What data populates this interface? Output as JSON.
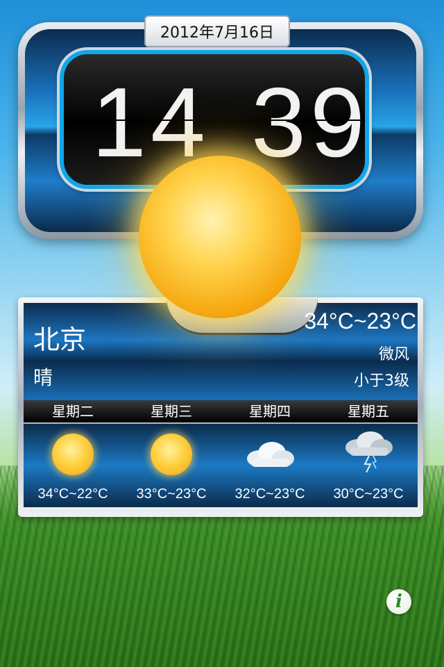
{
  "clock": {
    "date": "2012年7月16日",
    "hour": "14",
    "minute": "39"
  },
  "current": {
    "city": "北京",
    "condition": "晴",
    "temperature_range": "34°C~23°C",
    "wind": "微风",
    "wind_level": "小于3级",
    "icon": "sun-icon"
  },
  "forecast": [
    {
      "day": "星期二",
      "temp": "34°C~22°C",
      "icon": "sun-icon"
    },
    {
      "day": "星期三",
      "temp": "33°C~23°C",
      "icon": "sun-icon"
    },
    {
      "day": "星期四",
      "temp": "32°C~23°C",
      "icon": "cloud-icon"
    },
    {
      "day": "星期五",
      "temp": "30°C~23°C",
      "icon": "thunderstorm-icon"
    }
  ],
  "info_button": {
    "label": "i",
    "icon": "info-icon"
  },
  "colors": {
    "accent_blue": "#10a7ea",
    "sun_yellow": "#ffd24a",
    "info_green": "#2d8a2d"
  }
}
